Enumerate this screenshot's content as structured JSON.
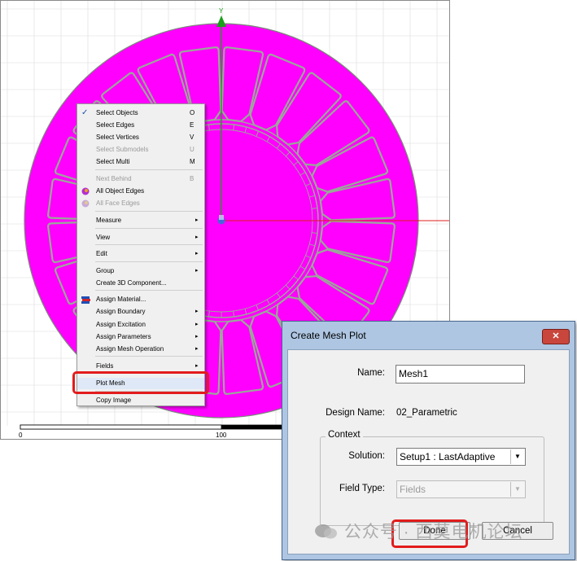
{
  "viewport": {
    "axis_y_label": "Y",
    "scale_bar": {
      "start_label": "0",
      "mid_label": "100"
    },
    "colors": {
      "part_fill": "#ff00ff",
      "outline": "#9aa898",
      "grid": "#dcdcdc",
      "axis_x": "#e21c1c",
      "axis_y": "#1aa01a"
    }
  },
  "context_menu": {
    "items": [
      {
        "label": "Select Objects",
        "shortcut": "O",
        "checked": true
      },
      {
        "label": "Select Edges",
        "shortcut": "E"
      },
      {
        "label": "Select Vertices",
        "shortcut": "V"
      },
      {
        "label": "Select Submodels",
        "shortcut": "U",
        "disabled": true
      },
      {
        "label": "Select Multi",
        "shortcut": "M"
      },
      {
        "label": "Next Behind",
        "shortcut": "B",
        "disabled": true
      },
      {
        "label": "All Object Edges",
        "icon": "object-edges-icon"
      },
      {
        "label": "All Face Edges",
        "icon": "face-edges-icon",
        "disabled": true
      },
      {
        "label": "Measure",
        "submenu": true
      },
      {
        "label": "View",
        "submenu": true
      },
      {
        "label": "Edit",
        "submenu": true
      },
      {
        "label": "Group",
        "submenu": true
      },
      {
        "label": "Create 3D Component..."
      },
      {
        "label": "Assign Material...",
        "icon": "material-icon"
      },
      {
        "label": "Assign Boundary",
        "submenu": true
      },
      {
        "label": "Assign Excitation",
        "submenu": true
      },
      {
        "label": "Assign Parameters",
        "submenu": true
      },
      {
        "label": "Assign Mesh Operation",
        "submenu": true
      },
      {
        "label": "Fields",
        "submenu": true
      },
      {
        "label": "Plot Mesh",
        "highlighted": true
      },
      {
        "label": "Copy Image"
      }
    ],
    "submenu_arrow": "▸",
    "check_mark": "✓"
  },
  "dialog": {
    "title": "Create Mesh Plot",
    "close_glyph": "✕",
    "name_label": "Name:",
    "name_value": "Mesh1",
    "design_name_label": "Design Name:",
    "design_name_value": "02_Parametric",
    "context_label": "Context",
    "solution_label": "Solution:",
    "solution_value": "Setup1 : LastAdaptive",
    "field_type_label": "Field Type:",
    "field_type_value": "Fields",
    "dropdown_glyph": "▼",
    "done_label": "Done",
    "cancel_label": "Cancel"
  },
  "watermark": {
    "text": "公众号 · 西莫电机论坛"
  },
  "highlight_color": "#e21c1c"
}
